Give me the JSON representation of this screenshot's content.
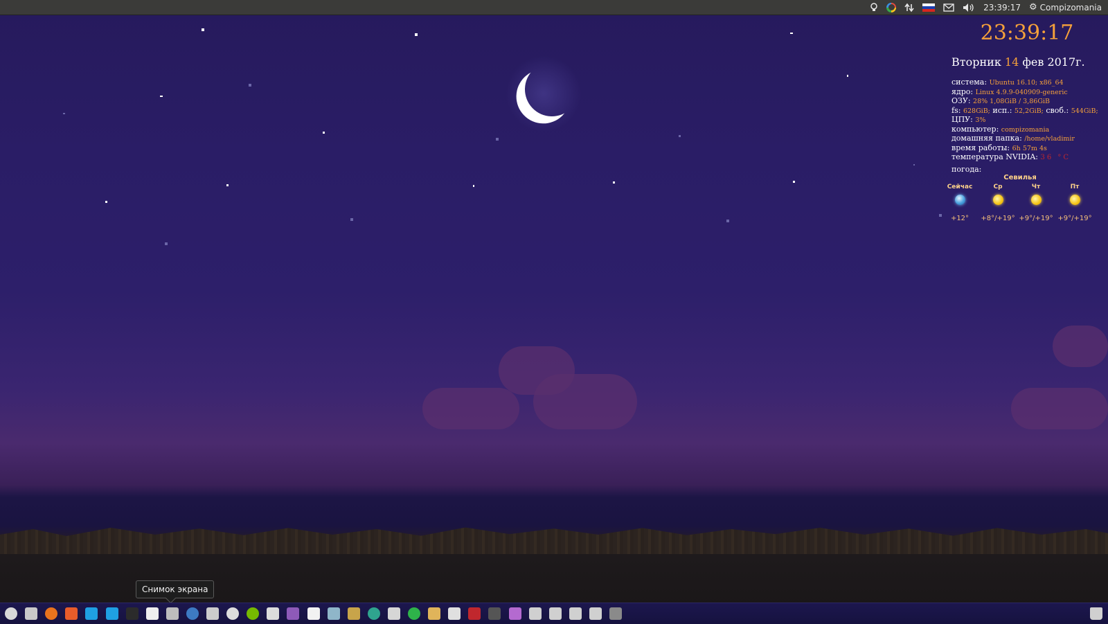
{
  "top_panel": {
    "clock": "23:39:17",
    "user": "Compizomania",
    "flag_colors": [
      "#ffffff",
      "#1a3fae",
      "#d8261f"
    ],
    "icons": [
      "lightbulb-icon",
      "media-player-icon",
      "network-transfer-icon",
      "keyboard-layout-flag-icon",
      "mail-icon",
      "volume-icon",
      "power-gear-icon"
    ]
  },
  "conky": {
    "clock": "23:39:17",
    "date_weekday": "Вторник",
    "date_day": "14",
    "date_rest": "фев 2017г.",
    "system_label": "система:",
    "system_value": "Ubuntu 16.10; x86_64",
    "kernel_label": "ядро:",
    "kernel_value": "Linux 4.9.9-040909-generic",
    "ram_label": "ОЗУ:",
    "ram_value": "28% 1,08GiB / 3,86GiB",
    "fs_label": "fs:",
    "fs_total": "628GiB;",
    "fs_used_label": "исп.:",
    "fs_used": "52,2GiB;",
    "fs_free_label": "своб.:",
    "fs_free": "544GiB;",
    "cpu_label": "ЦПУ:",
    "cpu_value": "3%",
    "computer_label": "компьютер:",
    "computer_value": "compizomania",
    "home_label": "домашняя папка:",
    "home_value": "/home/vladimir",
    "uptime_label": "время работы:",
    "uptime_value": "6h 57m 4s",
    "nvidia_label": "температура NVIDIA:",
    "nvidia_value": "36 °C",
    "weather_label": "погода:",
    "accent_color": "#f6a13a"
  },
  "weather": {
    "city": "Севилья",
    "days": [
      {
        "day": "Сейчас",
        "icon": "night-clear-icon",
        "temp": "+12°"
      },
      {
        "day": "Ср",
        "icon": "sun-icon",
        "temp": "+8°/+19°"
      },
      {
        "day": "Чт",
        "icon": "sun-icon",
        "temp": "+9°/+19°"
      },
      {
        "day": "Пт",
        "icon": "sun-icon",
        "temp": "+9°/+19°"
      }
    ]
  },
  "dock": {
    "tooltip": "Снимок экрана",
    "apps": [
      {
        "name": "settings-app-icon",
        "color": "#d8d8d8"
      },
      {
        "name": "file-manager-icon",
        "color": "#c9c9c9"
      },
      {
        "name": "firefox-icon",
        "color": "#e8731d"
      },
      {
        "name": "software-center-icon",
        "color": "#e85c2a"
      },
      {
        "name": "skype-icon",
        "color": "#1fa0e3"
      },
      {
        "name": "skype-icon",
        "color": "#1fa0e3"
      },
      {
        "name": "terminal-icon",
        "color": "#2b2b2b"
      },
      {
        "name": "text-editor-icon",
        "color": "#eeeeee"
      },
      {
        "name": "screenshot-icon",
        "color": "#bdbdbd"
      },
      {
        "name": "steam-icon",
        "color": "#3d7ac2"
      },
      {
        "name": "system-tools-icon",
        "color": "#cccccc"
      },
      {
        "name": "updater-icon",
        "color": "#dddddd"
      },
      {
        "name": "nvidia-settings-icon",
        "color": "#76b900"
      },
      {
        "name": "search-tool-icon",
        "color": "#dcdcdc"
      },
      {
        "name": "backup-icon",
        "color": "#8e5ab8"
      },
      {
        "name": "cards-game-icon",
        "color": "#f2f2f2"
      },
      {
        "name": "disk-usage-icon",
        "color": "#8fb6c9"
      },
      {
        "name": "archive-manager-icon",
        "color": "#c8a44a"
      },
      {
        "name": "clementine-icon",
        "color": "#2fa48e"
      },
      {
        "name": "image-viewer-icon",
        "color": "#d6d6d6"
      },
      {
        "name": "sync-icon",
        "color": "#2eb34a"
      },
      {
        "name": "files-folder-icon",
        "color": "#e0b45a"
      },
      {
        "name": "presentation-icon",
        "color": "#e0e0e0"
      },
      {
        "name": "font-viewer-icon",
        "color": "#c0272d"
      },
      {
        "name": "media-tool-icon",
        "color": "#555555"
      },
      {
        "name": "photo-app-icon",
        "color": "#b46ad0"
      },
      {
        "name": "drive-icon",
        "color": "#d0d0d0"
      },
      {
        "name": "drive-icon",
        "color": "#d0d0d0"
      },
      {
        "name": "drive-icon",
        "color": "#d0d0d0"
      },
      {
        "name": "drive-icon",
        "color": "#d0d0d0"
      },
      {
        "name": "phone-device-icon",
        "color": "#8a8a8a"
      }
    ],
    "trash": {
      "name": "trash-icon",
      "color": "#d0d0d0"
    }
  }
}
